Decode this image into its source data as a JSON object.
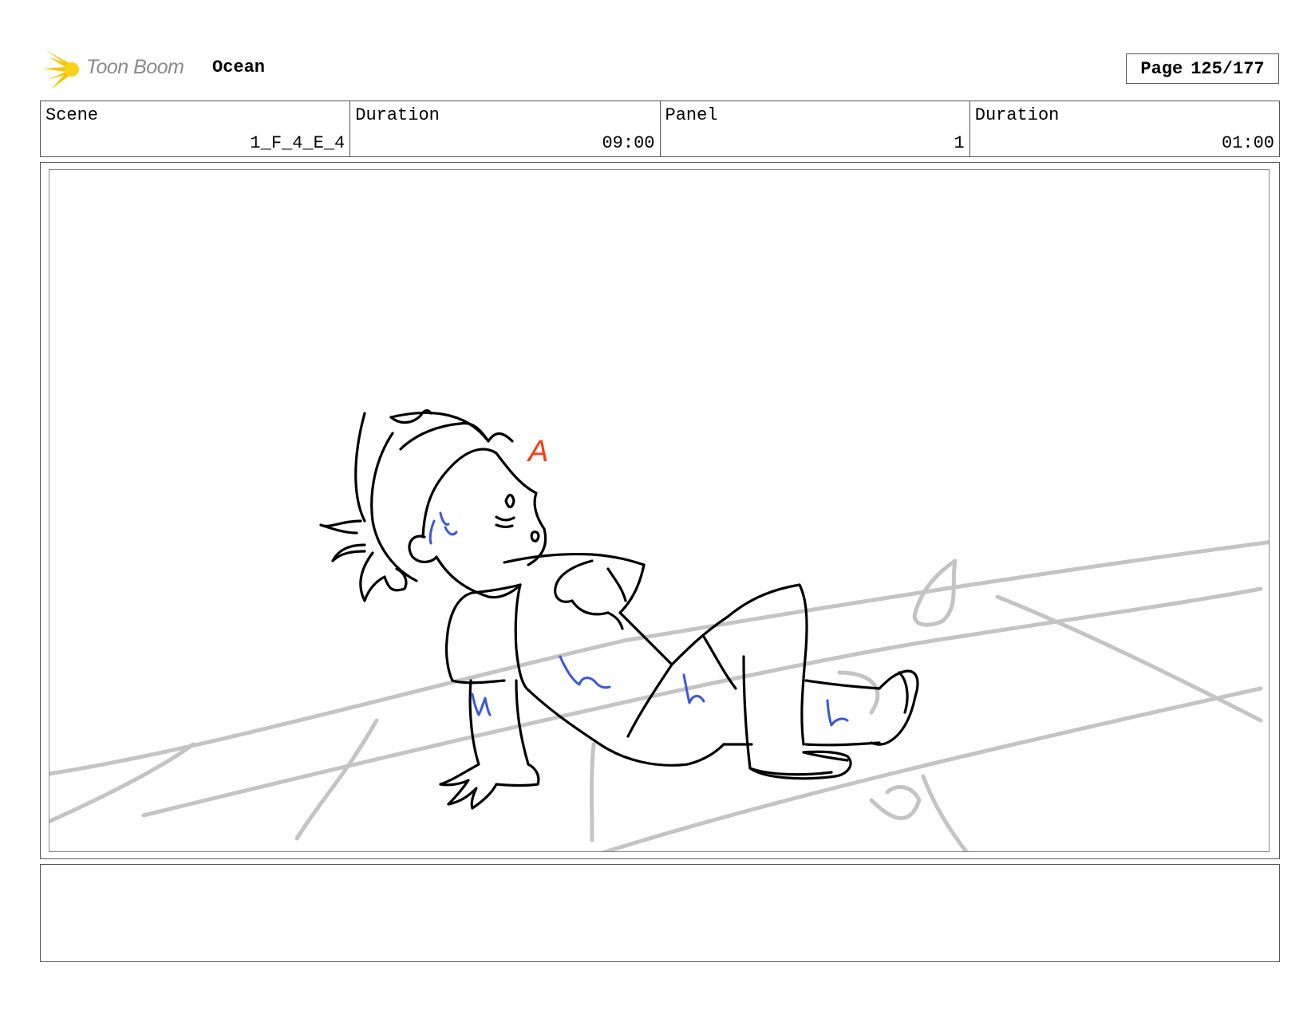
{
  "header": {
    "brand": "Toon Boom",
    "project": "Ocean",
    "page_label": "Page",
    "page_value": "125/177"
  },
  "info": {
    "scene_label": "Scene",
    "scene_value": "1_F_4_E_4",
    "scene_duration_label": "Duration",
    "scene_duration_value": "09:00",
    "panel_label": "Panel",
    "panel_value": "1",
    "panel_duration_label": "Duration",
    "panel_duration_value": "01:00"
  },
  "drawing": {
    "marker_letter": "A",
    "colors": {
      "ink": "#000000",
      "ground": "#c4c4c4",
      "accent_blue": "#3a56e0",
      "marker_red": "#ff3a10",
      "logo_yellow": "#f6c400"
    }
  },
  "notes": {
    "text": ""
  }
}
